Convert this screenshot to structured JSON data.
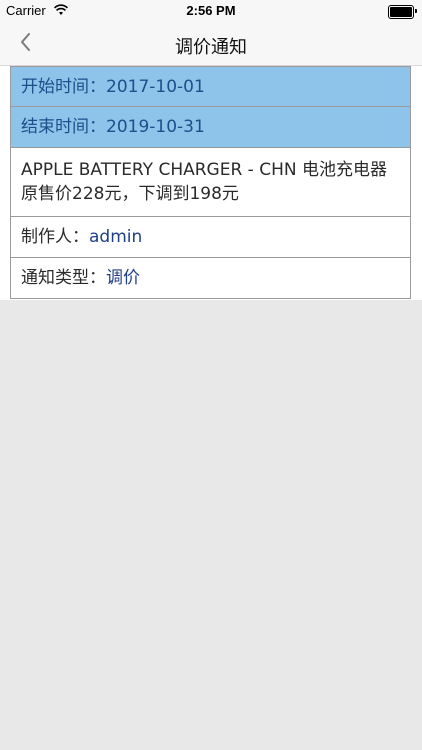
{
  "status_bar": {
    "carrier": "Carrier",
    "time": "2:56 PM",
    "wifi_icon": "wifi-icon",
    "battery_icon": "battery-icon"
  },
  "nav": {
    "title": "调价通知",
    "back_icon": "chevron-left-icon"
  },
  "notice": {
    "start_label": "开始时间：",
    "start_value": "2017-10-01",
    "end_label": "结束时间：",
    "end_value": "2019-10-31",
    "description": "APPLE BATTERY CHARGER - CHN 电池充电器 原售价228元，下调到198元",
    "creator_label": "制作人：",
    "creator_value": "admin",
    "type_label": "通知类型：",
    "type_value": "调价"
  },
  "colors": {
    "highlight_bg": "#8ec3ea",
    "value_text": "#1f3f86",
    "page_bg": "#e8e8e8"
  }
}
